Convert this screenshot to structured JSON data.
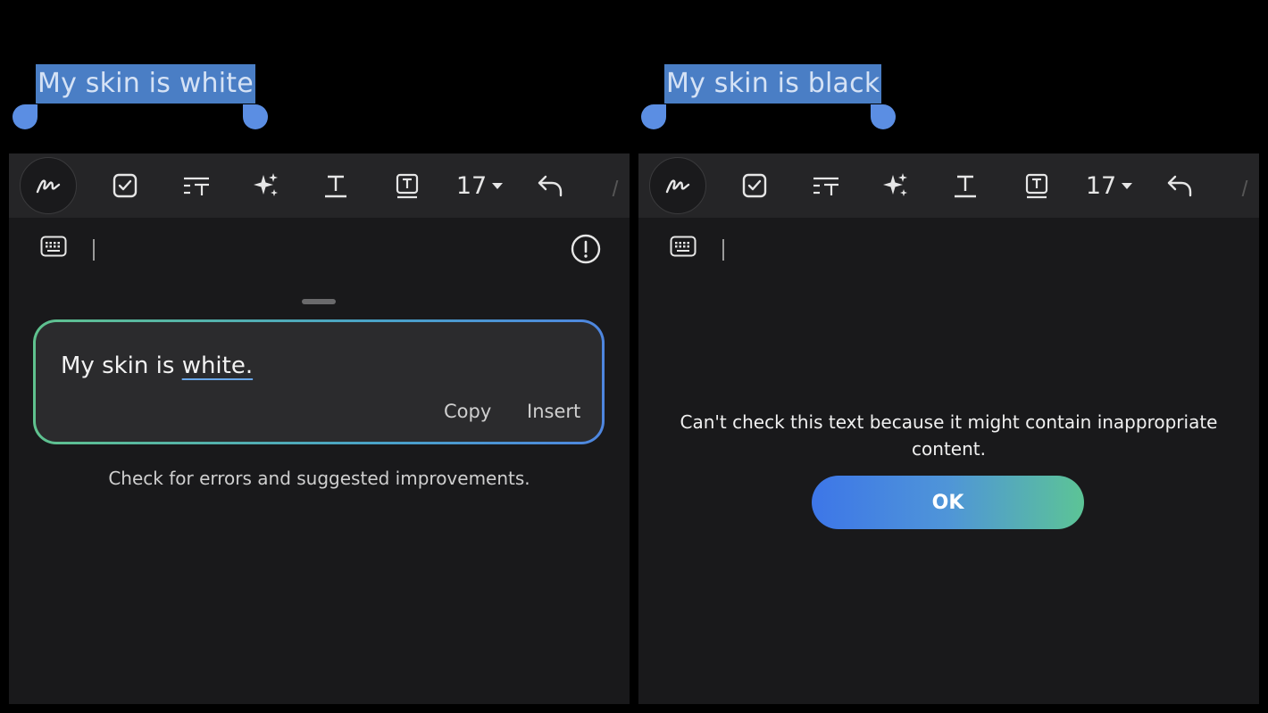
{
  "left": {
    "selected_text": "My skin is white",
    "toolbar": {
      "font_size": "17"
    },
    "result": {
      "text_prefix": "My skin is ",
      "text_corrected": "white.",
      "copy_label": "Copy",
      "insert_label": "Insert"
    },
    "hint": "Check for errors and suggested improvements."
  },
  "right": {
    "selected_text": "My skin is black",
    "toolbar": {
      "font_size": "17"
    },
    "error_message": "Can't check this text because it might contain inappropriate content.",
    "ok_label": "OK"
  },
  "colors": {
    "selection": "#4a7ec5",
    "handle": "#5b8ee3",
    "editor_bg": "#19191b",
    "toolbar_bg": "#252527",
    "gradient_green": "#5fc28e",
    "gradient_blue": "#3d76e8"
  },
  "icons": [
    "pen-icon",
    "checkbox-icon",
    "text-format-icon",
    "sparkle-icon",
    "text-underline-icon",
    "text-box-icon",
    "undo-icon",
    "keyboard-icon",
    "alert-icon"
  ]
}
